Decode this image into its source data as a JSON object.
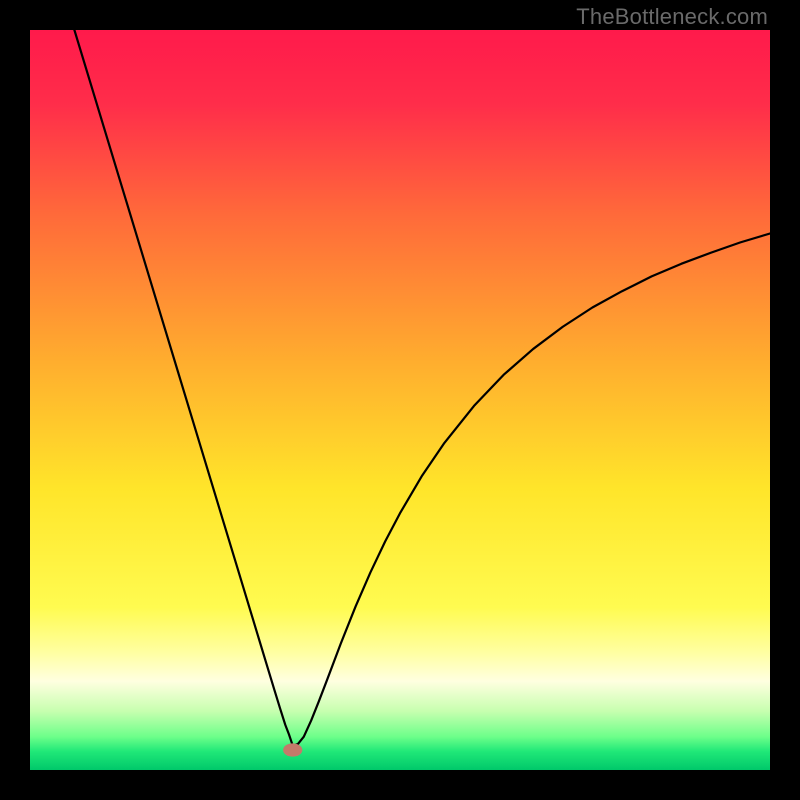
{
  "watermark": "TheBottleneck.com",
  "chart_data": {
    "type": "line",
    "title": "",
    "xlabel": "",
    "ylabel": "",
    "xlim": [
      0,
      100
    ],
    "ylim": [
      0,
      100
    ],
    "grid": false,
    "legend": false,
    "gradient_stops": [
      {
        "offset": 0.0,
        "color": "#ff1a4b"
      },
      {
        "offset": 0.1,
        "color": "#ff2d4a"
      },
      {
        "offset": 0.25,
        "color": "#ff6a3a"
      },
      {
        "offset": 0.45,
        "color": "#ffae2e"
      },
      {
        "offset": 0.62,
        "color": "#ffe52a"
      },
      {
        "offset": 0.78,
        "color": "#fffb50"
      },
      {
        "offset": 0.84,
        "color": "#ffffa0"
      },
      {
        "offset": 0.88,
        "color": "#ffffe0"
      },
      {
        "offset": 0.92,
        "color": "#c8ffb0"
      },
      {
        "offset": 0.955,
        "color": "#6dff8a"
      },
      {
        "offset": 0.975,
        "color": "#20e878"
      },
      {
        "offset": 1.0,
        "color": "#00c86a"
      }
    ],
    "marker": {
      "x": 35.5,
      "y": 97.3,
      "rx": 1.3,
      "ry": 0.9,
      "color": "#c47a6a"
    },
    "series": [
      {
        "name": "bottleneck-curve",
        "color": "#000000",
        "width": 2.2,
        "x": [
          6.0,
          8.0,
          10.0,
          12.0,
          14.0,
          16.0,
          18.0,
          20.0,
          22.0,
          24.0,
          26.0,
          28.0,
          30.0,
          31.0,
          32.0,
          33.0,
          33.8,
          34.5,
          35.0,
          35.5,
          36.2,
          37.0,
          38.0,
          39.0,
          40.0,
          42.0,
          44.0,
          46.0,
          48.0,
          50.0,
          53.0,
          56.0,
          60.0,
          64.0,
          68.0,
          72.0,
          76.0,
          80.0,
          84.0,
          88.0,
          92.0,
          96.0,
          100.0
        ],
        "y": [
          0.0,
          6.6,
          13.2,
          19.8,
          26.4,
          33.0,
          39.6,
          46.2,
          52.8,
          59.4,
          66.0,
          72.6,
          79.2,
          82.5,
          85.8,
          89.1,
          91.7,
          93.9,
          95.2,
          96.7,
          96.5,
          95.5,
          93.3,
          90.8,
          88.2,
          82.9,
          77.9,
          73.3,
          69.1,
          65.3,
          60.2,
          55.8,
          50.8,
          46.6,
          43.1,
          40.1,
          37.5,
          35.3,
          33.3,
          31.6,
          30.1,
          28.7,
          27.5
        ]
      }
    ]
  }
}
